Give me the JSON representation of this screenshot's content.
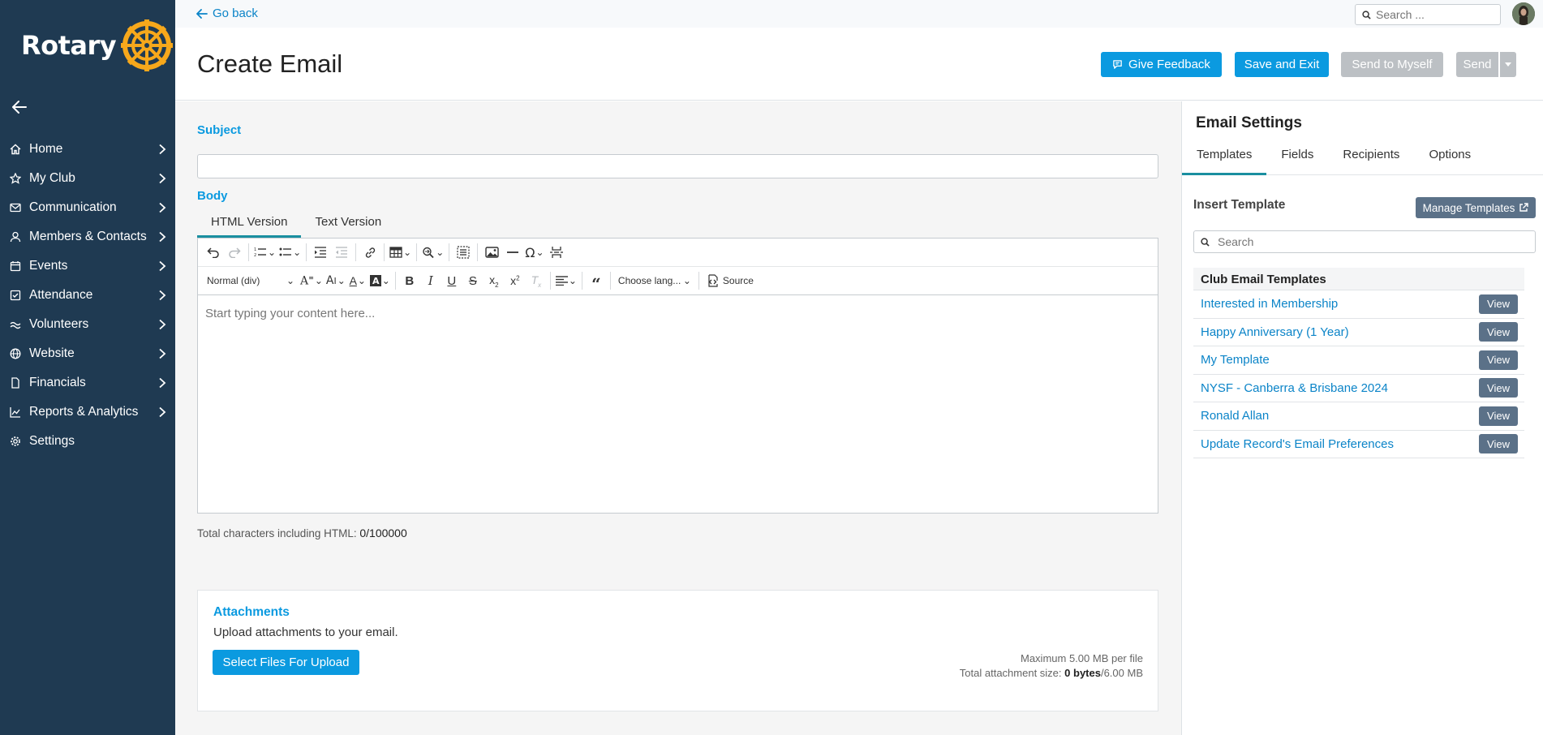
{
  "brand": {
    "name": "Rotary",
    "accent": "#0b9ae0",
    "sidebar_bg": "#1f3a52",
    "wheel_color": "#f7a81b"
  },
  "topbar": {
    "go_back": "Go back",
    "search_placeholder": "Search ..."
  },
  "header": {
    "title": "Create Email",
    "buttons": {
      "feedback": "Give Feedback",
      "save_exit": "Save and Exit",
      "send_myself": "Send to Myself",
      "send": "Send"
    }
  },
  "sidebar": {
    "items": [
      {
        "label": "Home",
        "icon": "home-icon",
        "has_children": true
      },
      {
        "label": "My Club",
        "icon": "star-icon",
        "has_children": true
      },
      {
        "label": "Communication",
        "icon": "envelope-icon",
        "has_children": true
      },
      {
        "label": "Members & Contacts",
        "icon": "user-icon",
        "has_children": true
      },
      {
        "label": "Events",
        "icon": "calendar-icon",
        "has_children": true
      },
      {
        "label": "Attendance",
        "icon": "check-square-icon",
        "has_children": true
      },
      {
        "label": "Volunteers",
        "icon": "hands-icon",
        "has_children": true
      },
      {
        "label": "Website",
        "icon": "globe-icon",
        "has_children": true
      },
      {
        "label": "Financials",
        "icon": "file-icon",
        "has_children": true
      },
      {
        "label": "Reports & Analytics",
        "icon": "chart-icon",
        "has_children": true
      },
      {
        "label": "Settings",
        "icon": "gear-icon",
        "has_children": false
      }
    ]
  },
  "form": {
    "subject_label": "Subject",
    "subject_value": "",
    "body_label": "Body",
    "tabs": [
      {
        "label": "HTML Version",
        "active": true
      },
      {
        "label": "Text Version",
        "active": false
      }
    ],
    "editor": {
      "format_select": "Normal (div)",
      "language_select": "Choose lang...",
      "source_label": "Source",
      "placeholder": "Start typing your content here..."
    },
    "char_count_label": "Total characters including HTML:",
    "char_count_value": "0/100000"
  },
  "attachments": {
    "title": "Attachments",
    "description": "Upload attachments to your email.",
    "upload_button": "Select Files For Upload",
    "max_label": "Maximum 5.00 MB per file",
    "total_label": "Total attachment size:",
    "total_used": "0 bytes",
    "total_max": "/6.00 MB"
  },
  "settings_panel": {
    "title": "Email Settings",
    "tabs": [
      {
        "label": "Templates",
        "active": true
      },
      {
        "label": "Fields",
        "active": false
      },
      {
        "label": "Recipients",
        "active": false
      },
      {
        "label": "Options",
        "active": false
      }
    ],
    "insert_template_label": "Insert Template",
    "manage_templates_button": "Manage Templates",
    "search_placeholder": "Search",
    "templates_header": "Club Email Templates",
    "view_label": "View",
    "templates": [
      "Interested in Membership",
      "Happy Anniversary (1 Year)",
      "My Template",
      "NYSF - Canberra & Brisbane 2024",
      "Ronald Allan",
      "Update Record's Email Preferences"
    ]
  }
}
